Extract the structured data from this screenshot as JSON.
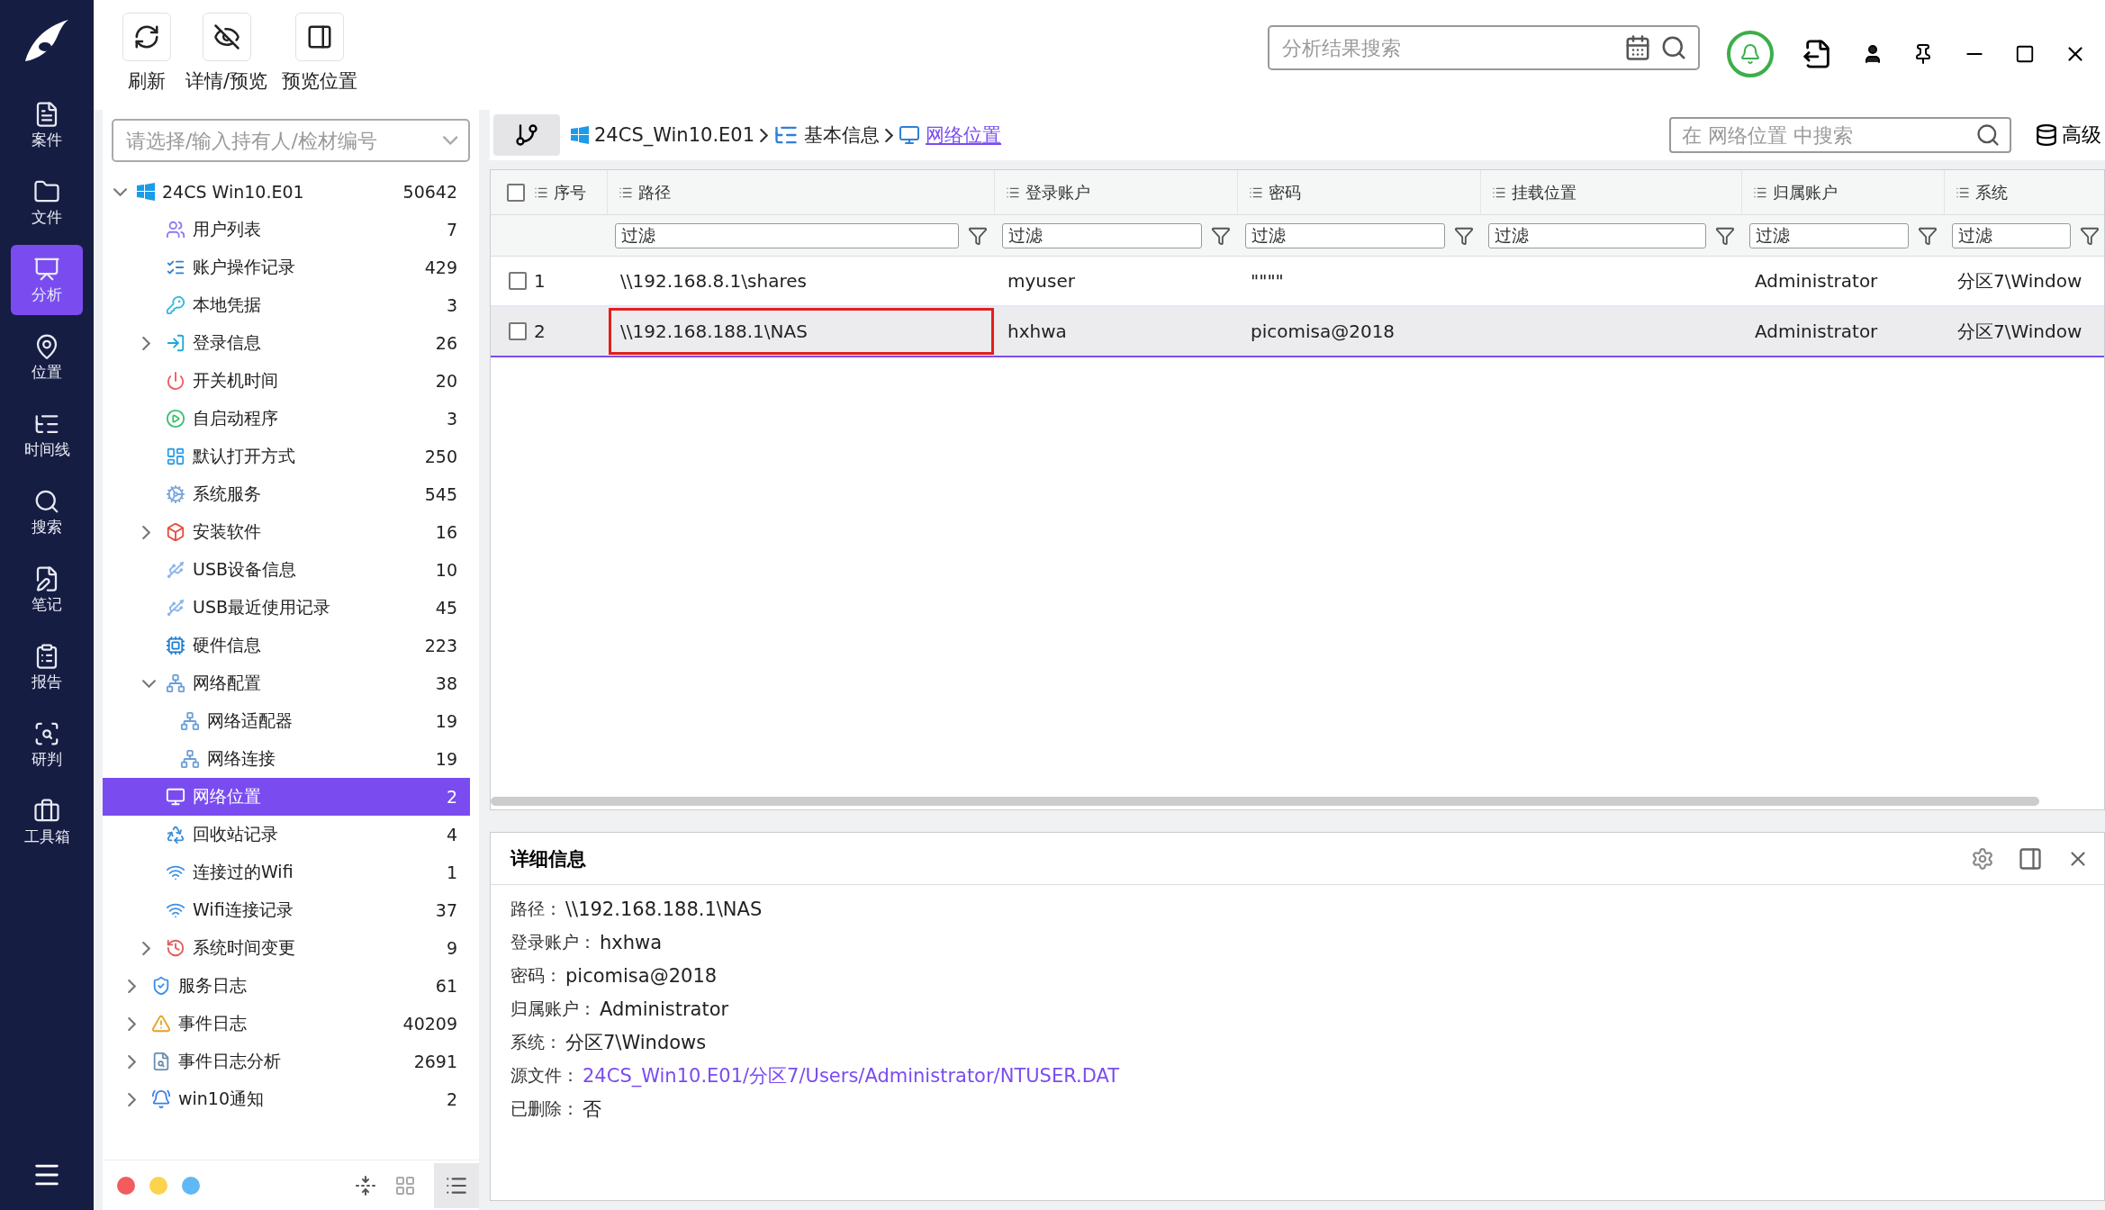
{
  "nav": {
    "items": [
      {
        "label": "案件",
        "selected": false
      },
      {
        "label": "文件",
        "selected": false
      },
      {
        "label": "分析",
        "selected": true
      },
      {
        "label": "位置",
        "selected": false
      },
      {
        "label": "时间线",
        "selected": false
      },
      {
        "label": "搜索",
        "selected": false
      },
      {
        "label": "笔记",
        "selected": false
      },
      {
        "label": "报告",
        "selected": false
      },
      {
        "label": "研判",
        "selected": false
      },
      {
        "label": "工具箱",
        "selected": false
      }
    ]
  },
  "toolbar": {
    "buttons": [
      "刷新",
      "详情/预览",
      "预览位置"
    ],
    "search_placeholder": "分析结果搜索"
  },
  "case_select": {
    "placeholder": "请选择/输入持有人/检材编号"
  },
  "tree": {
    "root": {
      "label": "24CS  Win10.E01",
      "count": "50642",
      "expanded": true,
      "children": [
        {
          "children": [
            {
              "label": "用户列表",
              "count": "7",
              "selected": false
            },
            {
              "label": "账户操作记录",
              "count": "429",
              "selected": false
            },
            {
              "label": "本地凭据",
              "count": "3",
              "selected": false
            },
            {
              "label": "登录信息",
              "count": "26",
              "selected": false,
              "expanded": false
            },
            {
              "label": "开关机时间",
              "count": "20",
              "selected": false
            },
            {
              "label": "自启动程序",
              "count": "3",
              "selected": false
            },
            {
              "label": "默认打开方式",
              "count": "250",
              "selected": false
            },
            {
              "label": "系统服务",
              "count": "545",
              "selected": false
            },
            {
              "label": "安装软件",
              "count": "16",
              "selected": false,
              "expanded": false
            },
            {
              "label": "USB设备信息",
              "count": "10",
              "selected": false
            },
            {
              "label": "USB最近使用记录",
              "count": "45",
              "selected": false
            },
            {
              "label": "硬件信息",
              "count": "223",
              "selected": false
            },
            {
              "label": "网络配置",
              "count": "38",
              "selected": false,
              "expanded": true,
              "children": [
                {
                  "label": "网络适配器",
                  "count": "19",
                  "selected": false
                },
                {
                  "label": "网络连接",
                  "count": "19",
                  "selected": false
                }
              ]
            },
            {
              "label": "网络位置",
              "count": "2",
              "selected": true
            },
            {
              "label": "回收站记录",
              "count": "4",
              "selected": false
            },
            {
              "label": "连接过的Wifi",
              "count": "1",
              "selected": false
            },
            {
              "label": "Wifi连接记录",
              "count": "37",
              "selected": false
            },
            {
              "label": "系统时间变更",
              "count": "9",
              "selected": false,
              "expanded": false
            }
          ]
        },
        {
          "label": "服务日志",
          "count": "61",
          "selected": false,
          "expanded": false
        },
        {
          "label": "事件日志",
          "count": "40209",
          "selected": false,
          "expanded": false
        },
        {
          "label": "事件日志分析",
          "count": "2691",
          "selected": false,
          "expanded": false
        },
        {
          "label": "win10通知",
          "count": "2",
          "selected": false,
          "expanded": false
        }
      ]
    }
  },
  "color_filters": [
    {
      "color": "#f25c5c"
    },
    {
      "color": "#fcd34d"
    },
    {
      "color": "#60b8f5"
    }
  ],
  "breadcrumb": [
    {
      "label": "24CS_Win10.E01",
      "selected": false
    },
    {
      "label": "基本信息",
      "selected": false
    },
    {
      "label": "网络位置",
      "selected": true
    }
  ],
  "table_search": {
    "placeholder": "在 网络位置 中搜索",
    "advanced": "高级"
  },
  "table": {
    "columns": [
      {
        "label": "序号"
      },
      {
        "label": "路径",
        "filter": "过滤"
      },
      {
        "label": "登录账户",
        "filter": "过滤"
      },
      {
        "label": "密码",
        "filter": "过滤"
      },
      {
        "label": "挂载位置",
        "filter": "过滤"
      },
      {
        "label": "归属账户",
        "filter": "过滤"
      },
      {
        "label": "系统",
        "filter": "过滤"
      }
    ],
    "rows": [
      {
        "index": "1",
        "path": "\\\\192.168.8.1\\shares",
        "account": "myuser",
        "password": "\"\"\"\"",
        "owner": "Administrator",
        "system": "分区7\\Window",
        "selected": false,
        "checked": false,
        "marked": false
      },
      {
        "index": "2",
        "path": "\\\\192.168.188.1\\NAS",
        "account": "hxhwa",
        "password": "picomisa@2018",
        "owner": "Administrator",
        "system": "分区7\\Window",
        "selected": true,
        "checked": false,
        "marked": true
      }
    ]
  },
  "details": {
    "title": "详细信息",
    "fields": [
      {
        "label": "路径：",
        "value": "\\\\192.168.188.1\\NAS",
        "kind": "text"
      },
      {
        "label": "登录账户：",
        "value": "hxhwa",
        "kind": "text"
      },
      {
        "label": "密码：",
        "value": "picomisa@2018",
        "kind": "text"
      },
      {
        "label": "归属账户：",
        "value": "Administrator",
        "kind": "text"
      },
      {
        "label": "系统：",
        "value": "分区7\\Windows",
        "kind": "text"
      },
      {
        "label": "源文件：",
        "value": "24CS_Win10.E01/分区7/Users/Administrator/NTUSER.DAT",
        "kind": "link"
      },
      {
        "label": "已删除：",
        "value": "否",
        "kind": "text"
      }
    ]
  }
}
